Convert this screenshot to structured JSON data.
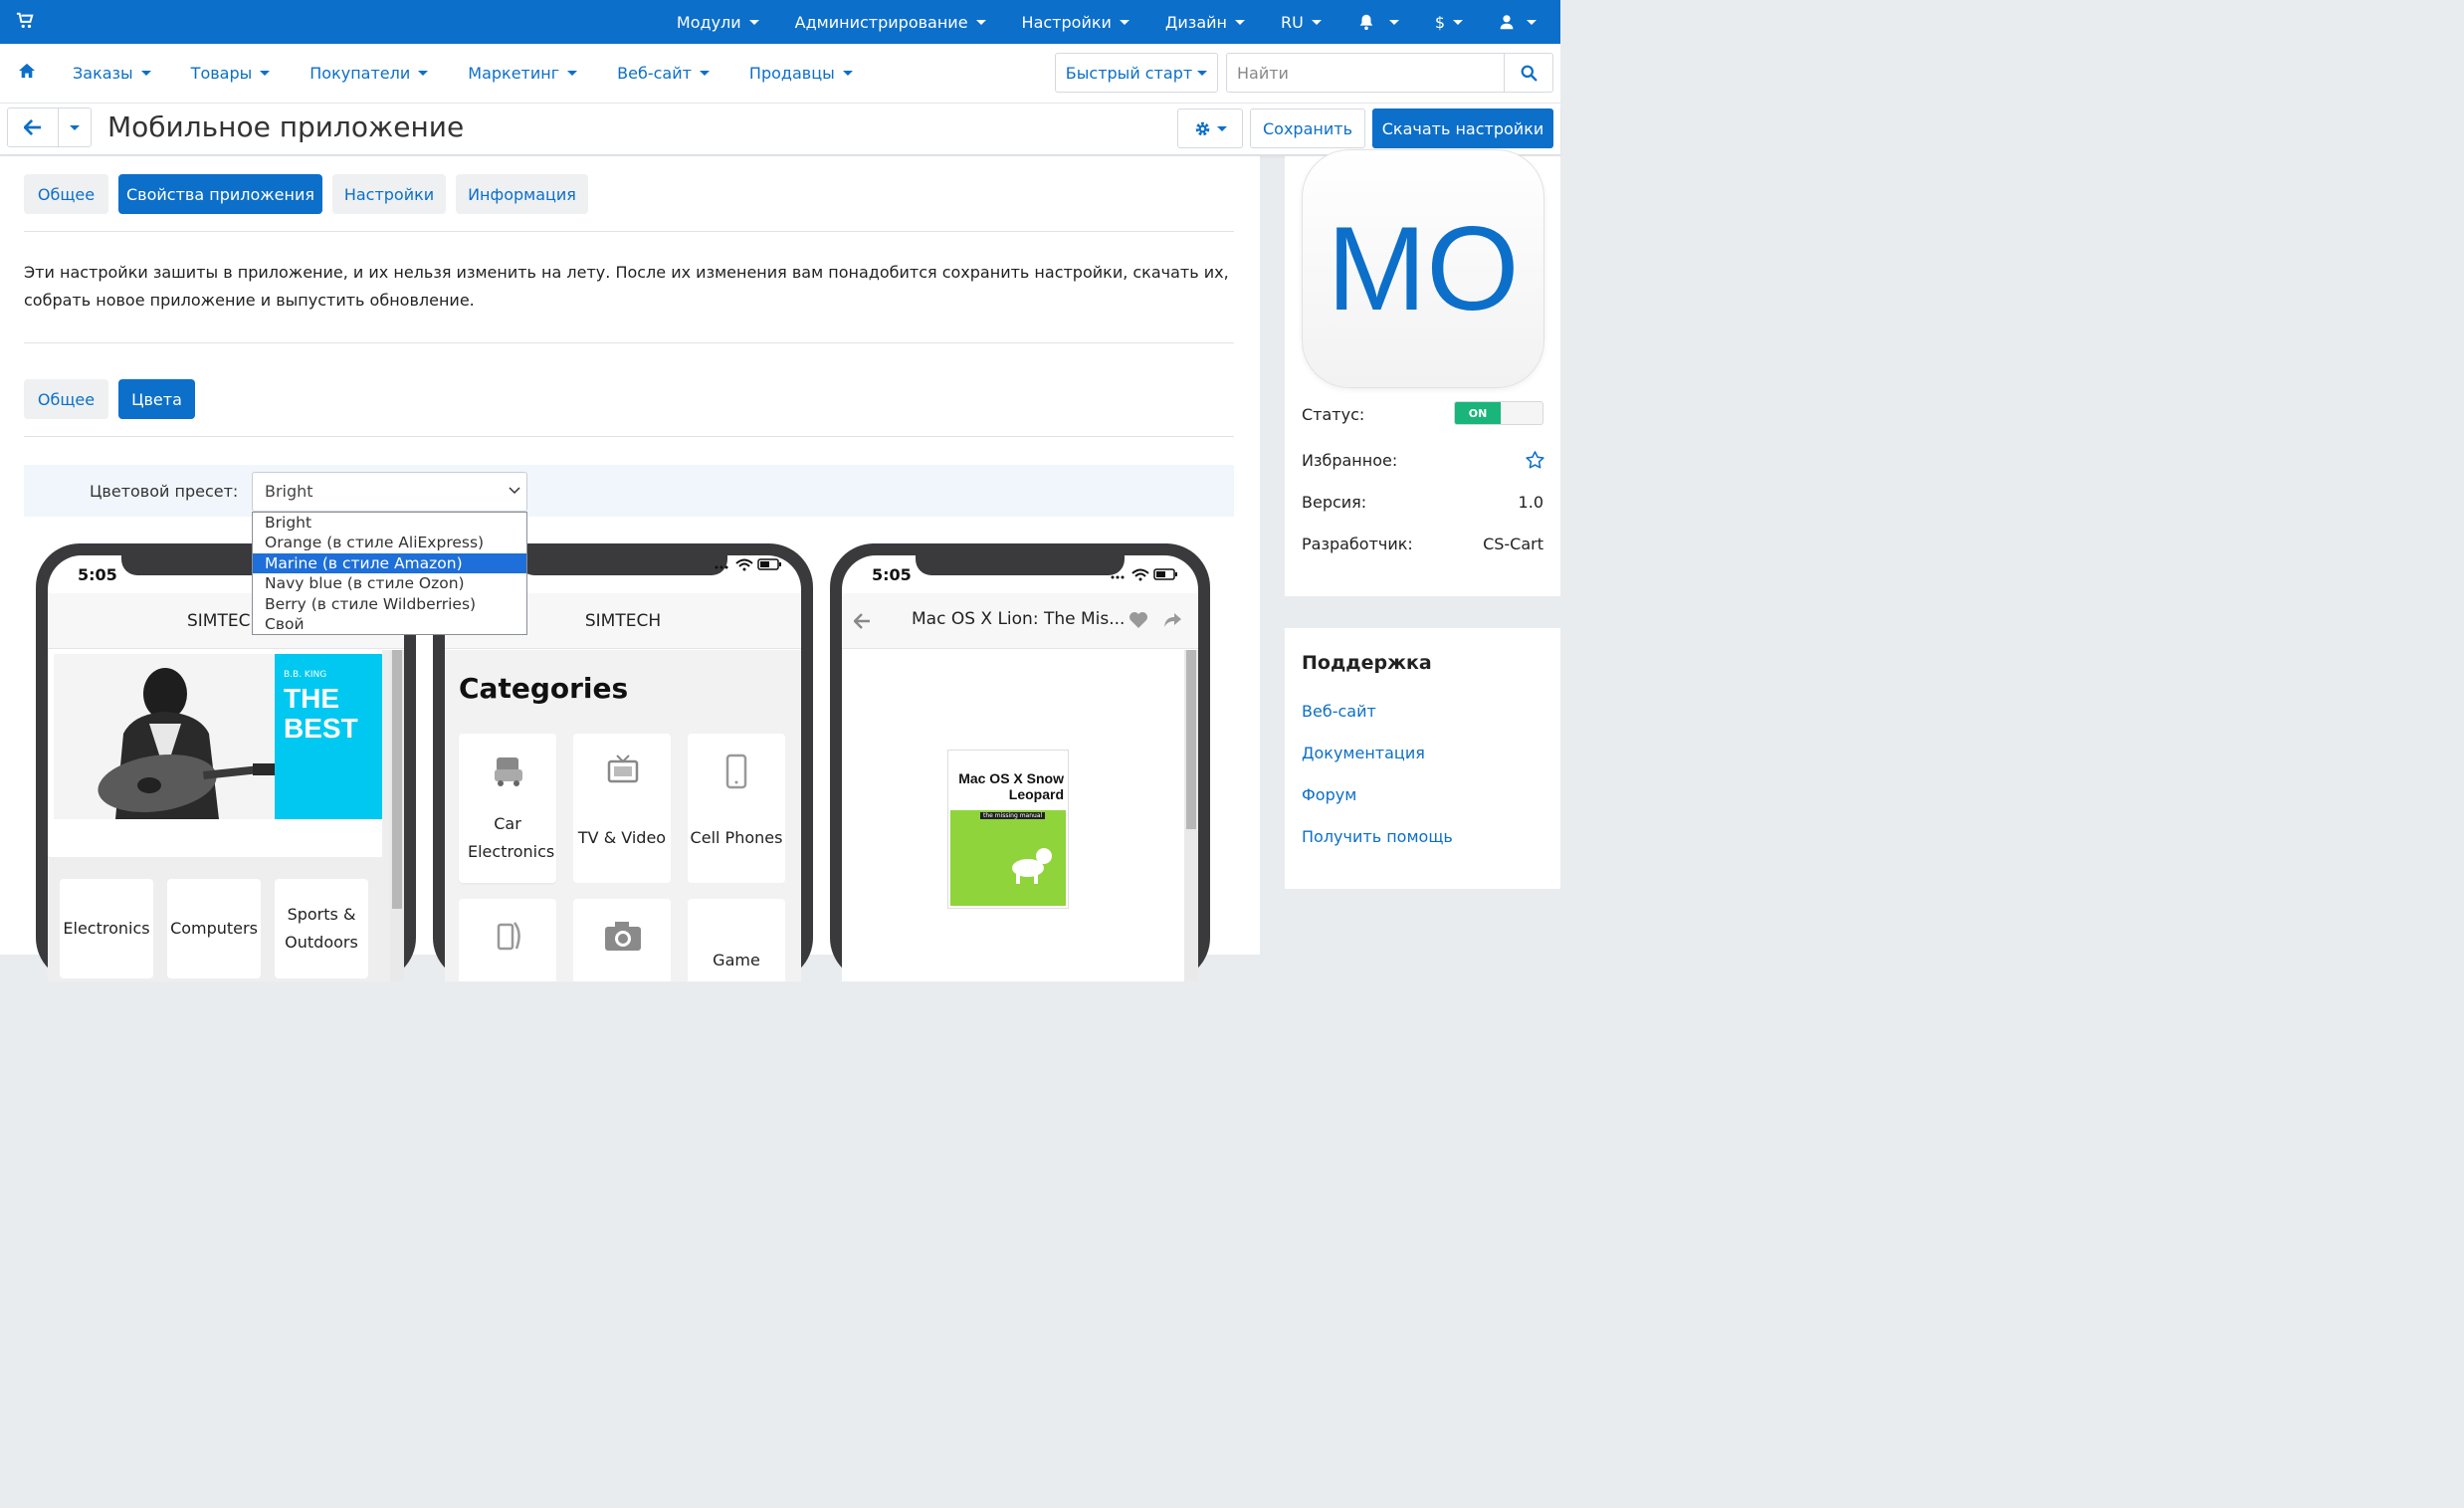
{
  "topbar": {
    "items": [
      {
        "label": "Модули"
      },
      {
        "label": "Администрирование"
      },
      {
        "label": "Настройки"
      },
      {
        "label": "Дизайн"
      },
      {
        "label": "RU"
      }
    ],
    "currency": "$"
  },
  "nav": {
    "items": [
      {
        "label": "Заказы"
      },
      {
        "label": "Товары"
      },
      {
        "label": "Покупатели"
      },
      {
        "label": "Маркетинг"
      },
      {
        "label": "Веб-сайт"
      },
      {
        "label": "Продавцы"
      }
    ],
    "quick_start": "Быстрый старт",
    "search_placeholder": "Найти"
  },
  "titlebar": {
    "title": "Мобильное приложение",
    "save": "Сохранить",
    "download": "Скачать настройки"
  },
  "tabs": [
    {
      "label": "Общее"
    },
    {
      "label": "Свойства приложения"
    },
    {
      "label": "Настройки"
    },
    {
      "label": "Информация"
    }
  ],
  "description": "Эти настройки зашиты в приложение, и их нельзя изменить на лету. После их изменения вам понадобится сохранить настройки, скачать их, собрать новое приложение и выпустить обновление.",
  "subtabs": [
    {
      "label": "Общее"
    },
    {
      "label": "Цвета"
    }
  ],
  "preset": {
    "label": "Цветовой пресет:",
    "value": "Bright",
    "options": [
      "Bright",
      "Orange (в стиле AliExpress)",
      "Marine (в стиле Amazon)",
      "Navy blue (в стиле Ozon)",
      "Berry (в стиле Wildberries)",
      "Свой"
    ],
    "highlighted": "Marine (в стиле Amazon)"
  },
  "phones": {
    "time": "5:05",
    "phone1": {
      "header": "SIMTECH",
      "banner_small": "B.B. KING",
      "banner_big": "THE BEST",
      "categories": [
        "Electronics",
        "Computers",
        "Sports & Outdoors"
      ]
    },
    "phone2": {
      "header": "SIMTECH",
      "heading": "Categories",
      "categories": [
        "Car Electronics",
        "TV & Video",
        "Cell Phones",
        "Game"
      ]
    },
    "phone3": {
      "header": "Mac OS X Lion: The Mis...",
      "book_title": "Mac OS X Snow Leopard",
      "book_tag": "the missing manual"
    }
  },
  "sidebar": {
    "app_initials": "MO",
    "status_label": "Статус:",
    "status_value": "ON",
    "favorite_label": "Избранное:",
    "version_label": "Версия:",
    "version_value": "1.0",
    "developer_label": "Разработчик:",
    "developer_value": "CS-Cart"
  },
  "support": {
    "title": "Поддержка",
    "links": [
      "Веб-сайт",
      "Документация",
      "Форум",
      "Получить помощь"
    ]
  },
  "colors": {
    "accent": "#0c6fc9",
    "status_on": "#19b57a",
    "banner_cyan": "#00c8f0",
    "book_green": "#8fd43a"
  }
}
